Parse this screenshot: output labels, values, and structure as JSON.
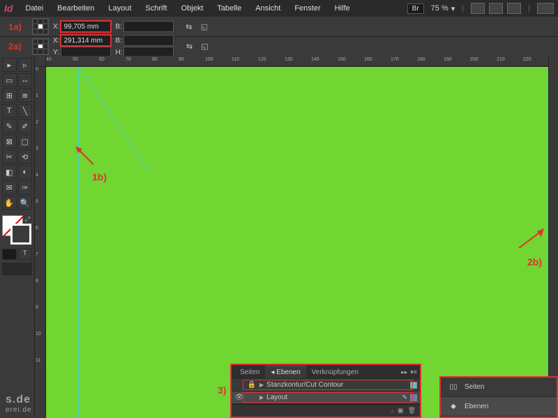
{
  "app": {
    "logo": "Id"
  },
  "menu": [
    "Datei",
    "Bearbeiten",
    "Layout",
    "Schrift",
    "Objekt",
    "Tabelle",
    "Ansicht",
    "Fenster",
    "Hilfe"
  ],
  "header": {
    "bridge": "Br",
    "zoom": "75 %"
  },
  "control_bars": [
    {
      "x_label": "X:",
      "x_value": "99,705 mm",
      "b_label": "B:",
      "b_value": "",
      "y_label": null,
      "h_label": null,
      "annot": "1a)"
    },
    {
      "x_label": "X:",
      "x_value": "291,314 mm",
      "b_label": "B:",
      "b_value": "",
      "y_label": "Y:",
      "y_value": "",
      "h_label": "H:",
      "h_value": "",
      "annot": "2a)"
    }
  ],
  "ruler_h": [
    "40",
    "50",
    "60",
    "70",
    "80",
    "90",
    "100",
    "110",
    "120",
    "130",
    "140",
    "150",
    "160",
    "170",
    "180",
    "190",
    "200",
    "210",
    "220"
  ],
  "ruler_v": [
    "0",
    "1",
    "2",
    "3",
    "4",
    "5",
    "6",
    "7",
    "8",
    "9",
    "10",
    "11"
  ],
  "annotations": {
    "arrow1": "1b)",
    "arrow2": "2b)",
    "panel_marker": "3)"
  },
  "layers_panel": {
    "tabs": [
      "Seiten",
      "Ebenen",
      "Verknüpfungen"
    ],
    "active_tab": 1,
    "rows": [
      {
        "locked": true,
        "visible": false,
        "name": "Stanzkontur/Cut Contour",
        "color": "#3fd0d0"
      },
      {
        "locked": false,
        "visible": true,
        "name": "Layout",
        "color": "#5a7fd0"
      }
    ]
  },
  "right_panel": {
    "rows": [
      {
        "icon": "pages-icon",
        "label": "Seiten"
      },
      {
        "icon": "layers-icon",
        "label": "Ebenen"
      }
    ],
    "active": 1
  },
  "watermark": {
    "line1": "s.de",
    "line2": "erei.de"
  }
}
